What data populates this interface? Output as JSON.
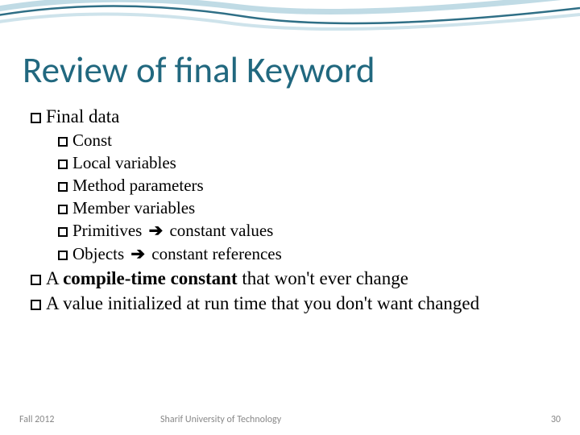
{
  "title": "Review of final Keyword",
  "bullets": {
    "b1": "Final data",
    "sub": {
      "s1": "Const",
      "s2": "Local variables",
      "s3": "Method parameters",
      "s4": "Member variables",
      "s5a": "Primitives",
      "s5b": "constant values",
      "s6a": "Objects",
      "s6b": "constant references"
    },
    "b2a": "A ",
    "b2b": "compile-time constant",
    "b2c": " that won't ever change",
    "b3": "A value initialized at run time that you don't want changed"
  },
  "arrow": "➔",
  "footer": {
    "left": "Fall 2012",
    "mid": "Sharif University of Technology",
    "right": "30"
  }
}
